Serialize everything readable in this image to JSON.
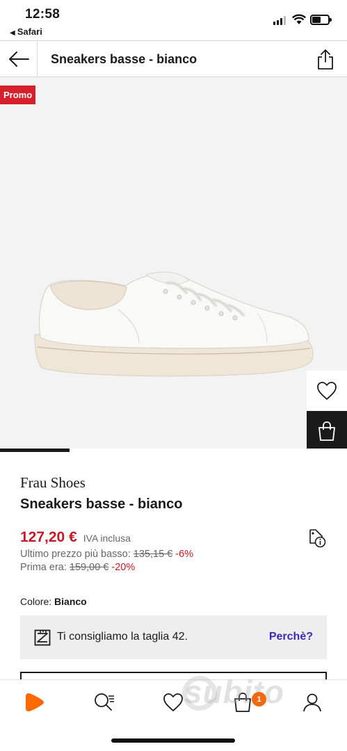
{
  "status_bar": {
    "time": "12:58",
    "back_app": "Safari",
    "back_arrow": "◀"
  },
  "nav": {
    "title": "Sneakers basse - bianco",
    "back_icon": "arrow-left-icon",
    "share_icon": "share-icon"
  },
  "gallery": {
    "promo_label": "Promo",
    "wishlist_icon": "heart-icon",
    "bag_icon": "bag-icon",
    "image_progress": 0.2
  },
  "product": {
    "brand": "Frau Shoes",
    "name": "Sneakers basse - bianco",
    "price": "127,20 €",
    "vat_label": "IVA inclusa",
    "lowest_label": "Ultimo prezzo più basso:",
    "lowest_price": "135,15 €",
    "lowest_discount": "-6%",
    "previous_label": "Prima era:",
    "previous_price": "159,00 €",
    "previous_discount": "-20%",
    "color_label": "Colore:",
    "color_value": "Bianco"
  },
  "size_advice": {
    "text": "Ti consigliamo la taglia 42.",
    "link": "Perchè?"
  },
  "tabbar": {
    "items": [
      {
        "name": "home",
        "icon": "zalando-logo-icon"
      },
      {
        "name": "search",
        "icon": "search-icon"
      },
      {
        "name": "wishlist",
        "icon": "heart-icon"
      },
      {
        "name": "bag",
        "icon": "bag-icon"
      },
      {
        "name": "profile",
        "icon": "profile-icon"
      }
    ],
    "bag_count": "1"
  },
  "watermark": "subito",
  "colors": {
    "promo": "#d6202b",
    "price": "#c41a25",
    "link": "#3b2ab3",
    "badge": "#ef6a12",
    "brand_orange": "#ff6900"
  }
}
